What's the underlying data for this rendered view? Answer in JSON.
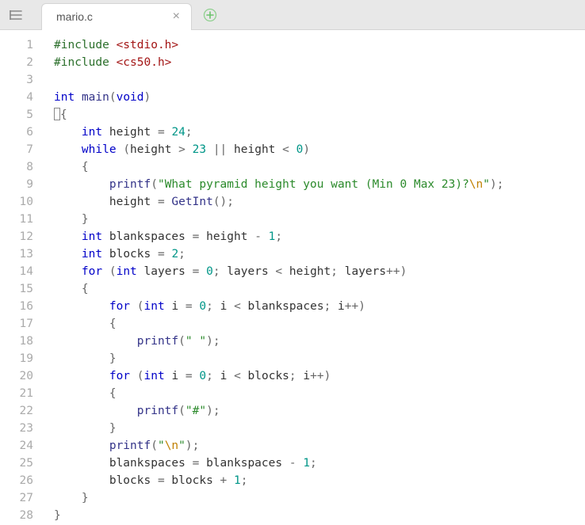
{
  "tabbar": {
    "menu_icon": "menu",
    "active_tab": {
      "label": "mario.c"
    },
    "add_icon": "plus"
  },
  "editor": {
    "line_start": 1,
    "line_end": 28,
    "lines": [
      [
        {
          "t": "pp",
          "v": "#include "
        },
        {
          "t": "hdr",
          "v": "<stdio.h>"
        }
      ],
      [
        {
          "t": "pp",
          "v": "#include "
        },
        {
          "t": "hdr",
          "v": "<cs50.h>"
        }
      ],
      [],
      [
        {
          "t": "kw",
          "v": "int"
        },
        {
          "t": "id",
          "v": " "
        },
        {
          "t": "fn",
          "v": "main"
        },
        {
          "t": "pun",
          "v": "("
        },
        {
          "t": "kw",
          "v": "void"
        },
        {
          "t": "pun",
          "v": ")"
        }
      ],
      [
        {
          "t": "cursor",
          "v": ""
        },
        {
          "t": "pun",
          "v": "{"
        }
      ],
      [
        {
          "t": "id",
          "v": "    "
        },
        {
          "t": "kw",
          "v": "int"
        },
        {
          "t": "id",
          "v": " height "
        },
        {
          "t": "op",
          "v": "="
        },
        {
          "t": "id",
          "v": " "
        },
        {
          "t": "num",
          "v": "24"
        },
        {
          "t": "pun",
          "v": ";"
        }
      ],
      [
        {
          "t": "id",
          "v": "    "
        },
        {
          "t": "kw",
          "v": "while"
        },
        {
          "t": "id",
          "v": " "
        },
        {
          "t": "pun",
          "v": "("
        },
        {
          "t": "id",
          "v": "height "
        },
        {
          "t": "op",
          "v": ">"
        },
        {
          "t": "id",
          "v": " "
        },
        {
          "t": "num",
          "v": "23"
        },
        {
          "t": "id",
          "v": " "
        },
        {
          "t": "op",
          "v": "||"
        },
        {
          "t": "id",
          "v": " height "
        },
        {
          "t": "op",
          "v": "<"
        },
        {
          "t": "id",
          "v": " "
        },
        {
          "t": "num",
          "v": "0"
        },
        {
          "t": "pun",
          "v": ")"
        }
      ],
      [
        {
          "t": "id",
          "v": "    "
        },
        {
          "t": "pun",
          "v": "{"
        }
      ],
      [
        {
          "t": "id",
          "v": "        "
        },
        {
          "t": "fn",
          "v": "printf"
        },
        {
          "t": "pun",
          "v": "("
        },
        {
          "t": "str",
          "v": "\"What pyramid height you want (Min 0 Max 23)?"
        },
        {
          "t": "esc",
          "v": "\\n"
        },
        {
          "t": "str",
          "v": "\""
        },
        {
          "t": "pun",
          "v": ");"
        }
      ],
      [
        {
          "t": "id",
          "v": "        height "
        },
        {
          "t": "op",
          "v": "="
        },
        {
          "t": "id",
          "v": " "
        },
        {
          "t": "fn",
          "v": "GetInt"
        },
        {
          "t": "pun",
          "v": "();"
        }
      ],
      [
        {
          "t": "id",
          "v": "    "
        },
        {
          "t": "pun",
          "v": "}"
        }
      ],
      [
        {
          "t": "id",
          "v": "    "
        },
        {
          "t": "kw",
          "v": "int"
        },
        {
          "t": "id",
          "v": " blankspaces "
        },
        {
          "t": "op",
          "v": "="
        },
        {
          "t": "id",
          "v": " height "
        },
        {
          "t": "op",
          "v": "-"
        },
        {
          "t": "id",
          "v": " "
        },
        {
          "t": "num",
          "v": "1"
        },
        {
          "t": "pun",
          "v": ";"
        }
      ],
      [
        {
          "t": "id",
          "v": "    "
        },
        {
          "t": "kw",
          "v": "int"
        },
        {
          "t": "id",
          "v": " blocks "
        },
        {
          "t": "op",
          "v": "="
        },
        {
          "t": "id",
          "v": " "
        },
        {
          "t": "num",
          "v": "2"
        },
        {
          "t": "pun",
          "v": ";"
        }
      ],
      [
        {
          "t": "id",
          "v": "    "
        },
        {
          "t": "kw",
          "v": "for"
        },
        {
          "t": "id",
          "v": " "
        },
        {
          "t": "pun",
          "v": "("
        },
        {
          "t": "kw",
          "v": "int"
        },
        {
          "t": "id",
          "v": " layers "
        },
        {
          "t": "op",
          "v": "="
        },
        {
          "t": "id",
          "v": " "
        },
        {
          "t": "num",
          "v": "0"
        },
        {
          "t": "pun",
          "v": ";"
        },
        {
          "t": "id",
          "v": " layers "
        },
        {
          "t": "op",
          "v": "<"
        },
        {
          "t": "id",
          "v": " height"
        },
        {
          "t": "pun",
          "v": ";"
        },
        {
          "t": "id",
          "v": " layers"
        },
        {
          "t": "op",
          "v": "++"
        },
        {
          "t": "pun",
          "v": ")"
        }
      ],
      [
        {
          "t": "id",
          "v": "    "
        },
        {
          "t": "pun",
          "v": "{"
        }
      ],
      [
        {
          "t": "id",
          "v": "        "
        },
        {
          "t": "kw",
          "v": "for"
        },
        {
          "t": "id",
          "v": " "
        },
        {
          "t": "pun",
          "v": "("
        },
        {
          "t": "kw",
          "v": "int"
        },
        {
          "t": "id",
          "v": " i "
        },
        {
          "t": "op",
          "v": "="
        },
        {
          "t": "id",
          "v": " "
        },
        {
          "t": "num",
          "v": "0"
        },
        {
          "t": "pun",
          "v": ";"
        },
        {
          "t": "id",
          "v": " i "
        },
        {
          "t": "op",
          "v": "<"
        },
        {
          "t": "id",
          "v": " blankspaces"
        },
        {
          "t": "pun",
          "v": ";"
        },
        {
          "t": "id",
          "v": " i"
        },
        {
          "t": "op",
          "v": "++"
        },
        {
          "t": "pun",
          "v": ")"
        }
      ],
      [
        {
          "t": "id",
          "v": "        "
        },
        {
          "t": "pun",
          "v": "{"
        }
      ],
      [
        {
          "t": "id",
          "v": "            "
        },
        {
          "t": "fn",
          "v": "printf"
        },
        {
          "t": "pun",
          "v": "("
        },
        {
          "t": "str",
          "v": "\" \""
        },
        {
          "t": "pun",
          "v": ");"
        }
      ],
      [
        {
          "t": "id",
          "v": "        "
        },
        {
          "t": "pun",
          "v": "}"
        }
      ],
      [
        {
          "t": "id",
          "v": "        "
        },
        {
          "t": "kw",
          "v": "for"
        },
        {
          "t": "id",
          "v": " "
        },
        {
          "t": "pun",
          "v": "("
        },
        {
          "t": "kw",
          "v": "int"
        },
        {
          "t": "id",
          "v": " i "
        },
        {
          "t": "op",
          "v": "="
        },
        {
          "t": "id",
          "v": " "
        },
        {
          "t": "num",
          "v": "0"
        },
        {
          "t": "pun",
          "v": ";"
        },
        {
          "t": "id",
          "v": " i "
        },
        {
          "t": "op",
          "v": "<"
        },
        {
          "t": "id",
          "v": " blocks"
        },
        {
          "t": "pun",
          "v": ";"
        },
        {
          "t": "id",
          "v": " i"
        },
        {
          "t": "op",
          "v": "++"
        },
        {
          "t": "pun",
          "v": ")"
        }
      ],
      [
        {
          "t": "id",
          "v": "        "
        },
        {
          "t": "pun",
          "v": "{"
        }
      ],
      [
        {
          "t": "id",
          "v": "            "
        },
        {
          "t": "fn",
          "v": "printf"
        },
        {
          "t": "pun",
          "v": "("
        },
        {
          "t": "str",
          "v": "\"#\""
        },
        {
          "t": "pun",
          "v": ");"
        }
      ],
      [
        {
          "t": "id",
          "v": "        "
        },
        {
          "t": "pun",
          "v": "}"
        }
      ],
      [
        {
          "t": "id",
          "v": "        "
        },
        {
          "t": "fn",
          "v": "printf"
        },
        {
          "t": "pun",
          "v": "("
        },
        {
          "t": "str",
          "v": "\""
        },
        {
          "t": "esc",
          "v": "\\n"
        },
        {
          "t": "str",
          "v": "\""
        },
        {
          "t": "pun",
          "v": ");"
        }
      ],
      [
        {
          "t": "id",
          "v": "        blankspaces "
        },
        {
          "t": "op",
          "v": "="
        },
        {
          "t": "id",
          "v": " blankspaces "
        },
        {
          "t": "op",
          "v": "-"
        },
        {
          "t": "id",
          "v": " "
        },
        {
          "t": "num",
          "v": "1"
        },
        {
          "t": "pun",
          "v": ";"
        }
      ],
      [
        {
          "t": "id",
          "v": "        blocks "
        },
        {
          "t": "op",
          "v": "="
        },
        {
          "t": "id",
          "v": " blocks "
        },
        {
          "t": "op",
          "v": "+"
        },
        {
          "t": "id",
          "v": " "
        },
        {
          "t": "num",
          "v": "1"
        },
        {
          "t": "pun",
          "v": ";"
        }
      ],
      [
        {
          "t": "id",
          "v": "    "
        },
        {
          "t": "pun",
          "v": "}"
        }
      ],
      [
        {
          "t": "pun",
          "v": "}"
        }
      ]
    ]
  }
}
